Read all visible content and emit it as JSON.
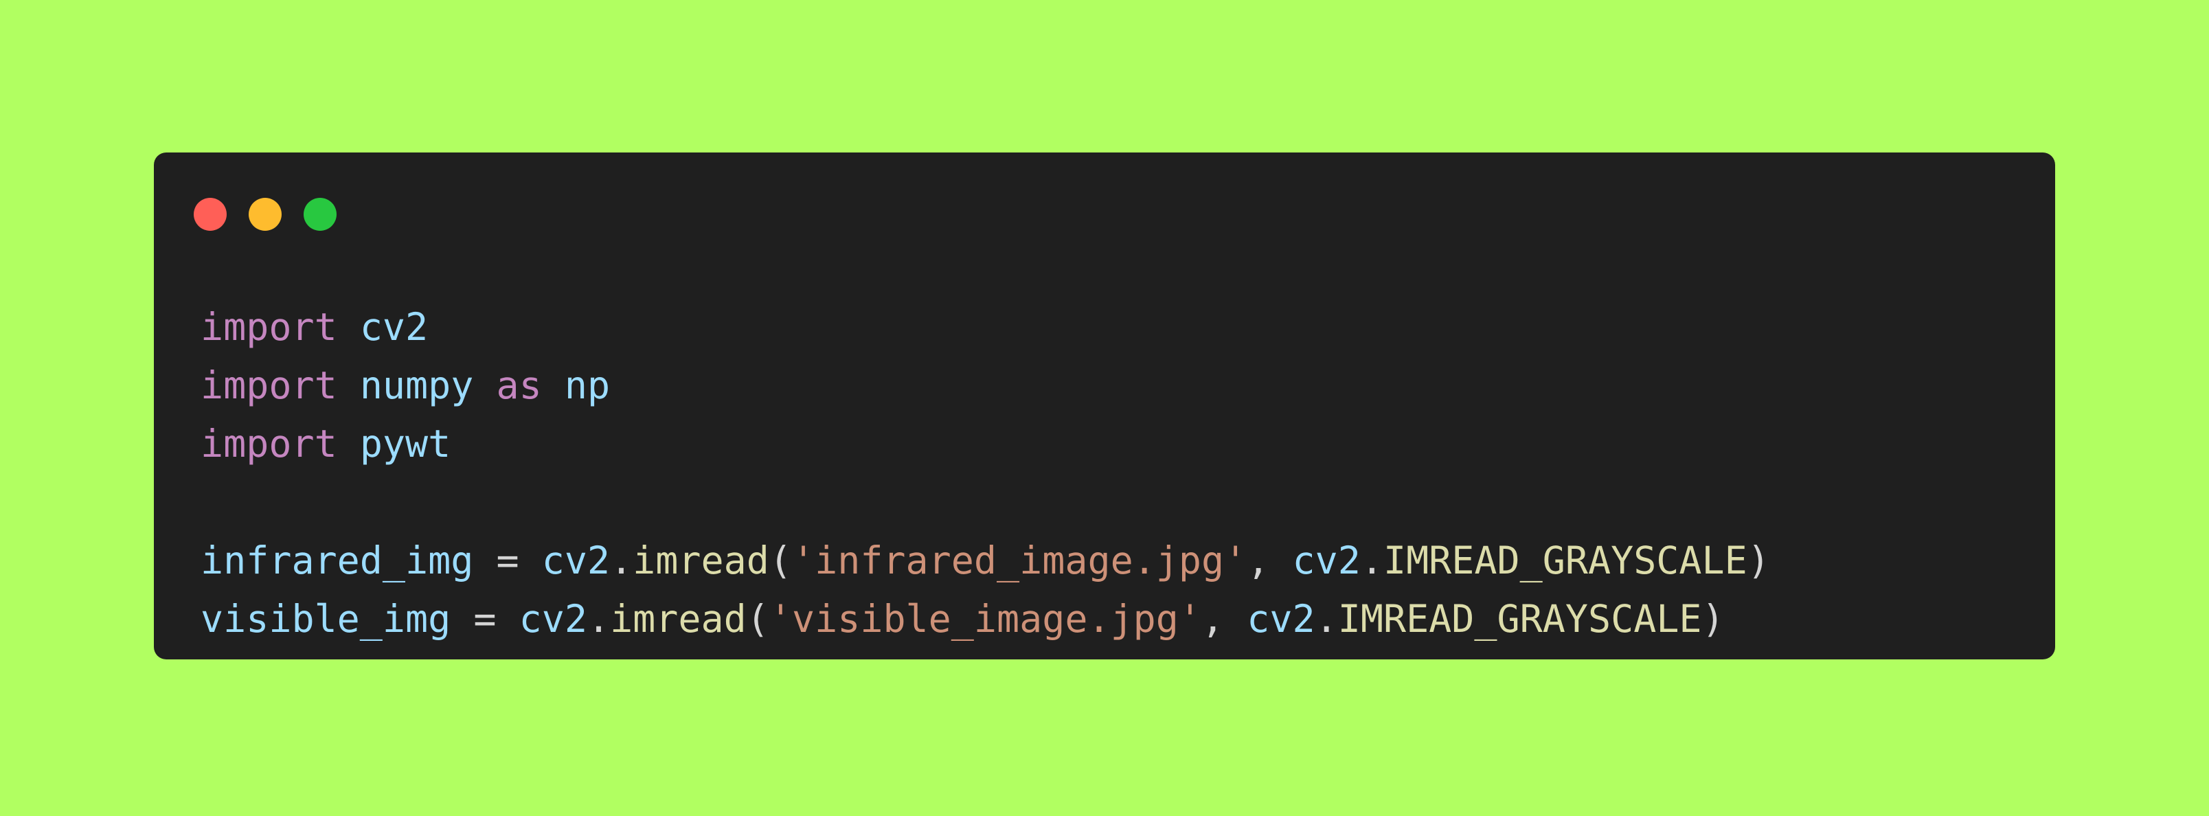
{
  "window": {
    "controls": [
      {
        "name": "close",
        "color": "#ff5f57"
      },
      {
        "name": "minimize",
        "color": "#febc2e"
      },
      {
        "name": "maximize",
        "color": "#28c840"
      }
    ]
  },
  "code": {
    "lines": [
      {
        "tokens": [
          {
            "text": "import",
            "type": "kw"
          },
          {
            "text": " ",
            "type": "plain"
          },
          {
            "text": "cv2",
            "type": "id"
          }
        ]
      },
      {
        "tokens": [
          {
            "text": "import",
            "type": "kw"
          },
          {
            "text": " ",
            "type": "plain"
          },
          {
            "text": "numpy",
            "type": "id"
          },
          {
            "text": " ",
            "type": "plain"
          },
          {
            "text": "as",
            "type": "kw"
          },
          {
            "text": " ",
            "type": "plain"
          },
          {
            "text": "np",
            "type": "id"
          }
        ]
      },
      {
        "tokens": [
          {
            "text": "import",
            "type": "kw"
          },
          {
            "text": " ",
            "type": "plain"
          },
          {
            "text": "pywt",
            "type": "id"
          }
        ]
      },
      {
        "tokens": []
      },
      {
        "tokens": [
          {
            "text": "infrared_img",
            "type": "id"
          },
          {
            "text": " = ",
            "type": "plain"
          },
          {
            "text": "cv2",
            "type": "id"
          },
          {
            "text": ".",
            "type": "plain"
          },
          {
            "text": "imread",
            "type": "fn"
          },
          {
            "text": "(",
            "type": "plain"
          },
          {
            "text": "'infrared_image.jpg'",
            "type": "str"
          },
          {
            "text": ", ",
            "type": "plain"
          },
          {
            "text": "cv2",
            "type": "id"
          },
          {
            "text": ".",
            "type": "plain"
          },
          {
            "text": "IMREAD_GRAYSCALE",
            "type": "fn"
          },
          {
            "text": ")",
            "type": "plain"
          }
        ]
      },
      {
        "tokens": [
          {
            "text": "visible_img",
            "type": "id"
          },
          {
            "text": " = ",
            "type": "plain"
          },
          {
            "text": "cv2",
            "type": "id"
          },
          {
            "text": ".",
            "type": "plain"
          },
          {
            "text": "imread",
            "type": "fn"
          },
          {
            "text": "(",
            "type": "plain"
          },
          {
            "text": "'visible_image.jpg'",
            "type": "str"
          },
          {
            "text": ", ",
            "type": "plain"
          },
          {
            "text": "cv2",
            "type": "id"
          },
          {
            "text": ".",
            "type": "plain"
          },
          {
            "text": "IMREAD_GRAYSCALE",
            "type": "fn"
          },
          {
            "text": ")",
            "type": "plain"
          }
        ]
      }
    ]
  }
}
